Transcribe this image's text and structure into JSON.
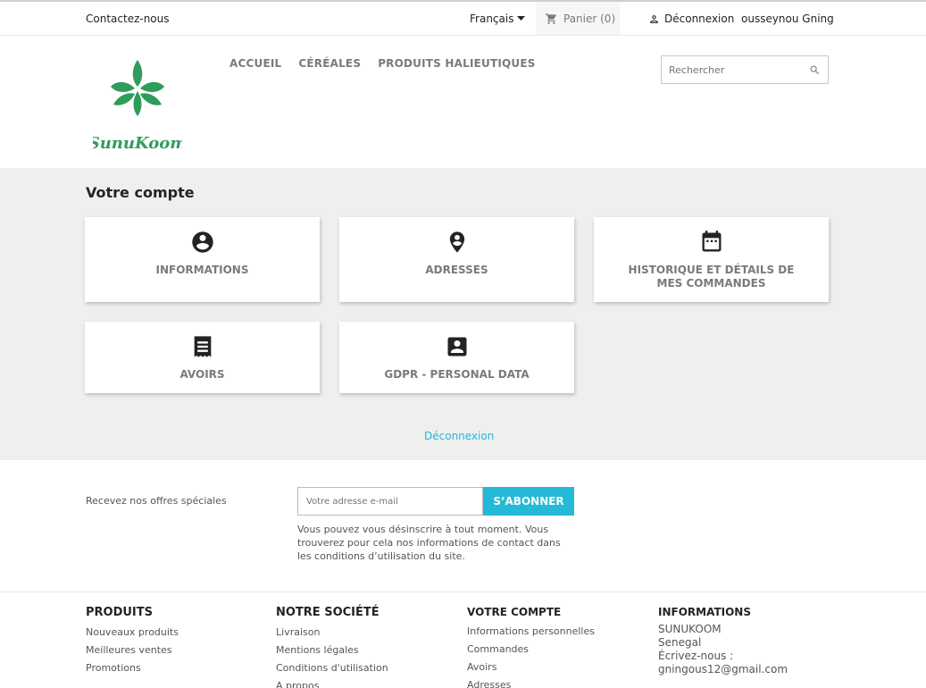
{
  "topbar": {
    "contact": "Contactez-nous",
    "language": "Français",
    "cart": "Panier (0)",
    "logout": "Déconnexion",
    "user": "ousseynou Gning"
  },
  "header": {
    "logo_text": "SunuKoom",
    "nav": [
      "Accueil",
      "Céréales",
      "Produits halieutiques"
    ],
    "search_placeholder": "Rechercher"
  },
  "account": {
    "title": "Votre compte",
    "cards": [
      {
        "label": "Informations",
        "icon": "account-circle-icon"
      },
      {
        "label": "Adresses",
        "icon": "location-pin-icon"
      },
      {
        "label": "Historique et détails de mes commandes",
        "icon": "calendar-icon"
      },
      {
        "label": "Avoirs",
        "icon": "receipt-icon"
      },
      {
        "label": "GDPR - Personal Data",
        "icon": "account-box-icon"
      }
    ],
    "logout_link": "Déconnexion"
  },
  "newsletter": {
    "label": "Recevez nos offres spéciales",
    "placeholder": "Votre adresse e-mail",
    "button": "S’abonner",
    "note": "Vous pouvez vous désinscrire à tout moment. Vous trouverez pour cela nos informations de contact dans les conditions d’utilisation du site."
  },
  "footer": {
    "products": {
      "title": "Produits",
      "items": [
        "Nouveaux produits",
        "Meilleures ventes",
        "Promotions"
      ]
    },
    "company": {
      "title": "Notre société",
      "items": [
        "Livraison",
        "Mentions légales",
        "Conditions d'utilisation",
        "A propos"
      ]
    },
    "account": {
      "title": "Votre compte",
      "items": [
        "Informations personnelles",
        "Commandes",
        "Avoirs",
        "Adresses"
      ]
    },
    "info": {
      "title": "Informations",
      "lines": [
        "SUNUKOOM",
        "Senegal",
        "Écrivez-nous :",
        "gningous12@gmail.com"
      ]
    }
  },
  "colors": {
    "accent": "#24b9d7",
    "logo_green": "#2e9c5a",
    "background_main": "#efefef"
  }
}
